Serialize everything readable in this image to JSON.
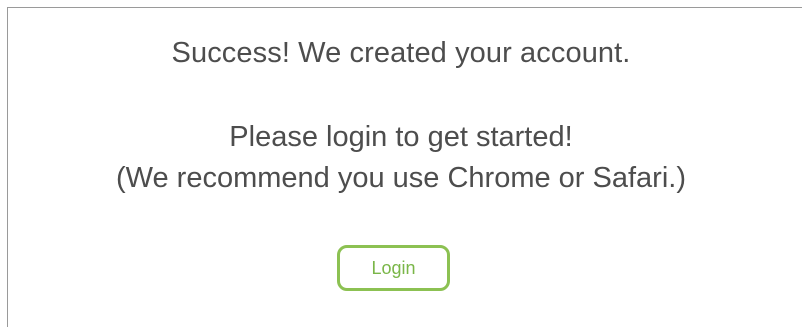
{
  "message": {
    "success": "Success! We created your account.",
    "instruction": "Please login to get started!",
    "recommendation": "(We recommend you use Chrome or Safari.)"
  },
  "actions": {
    "login_label": "Login"
  },
  "colors": {
    "text": "#4d4d4d",
    "button_border": "#8cc152",
    "button_text": "#7ab648",
    "frame_border": "#9a9a9a"
  }
}
